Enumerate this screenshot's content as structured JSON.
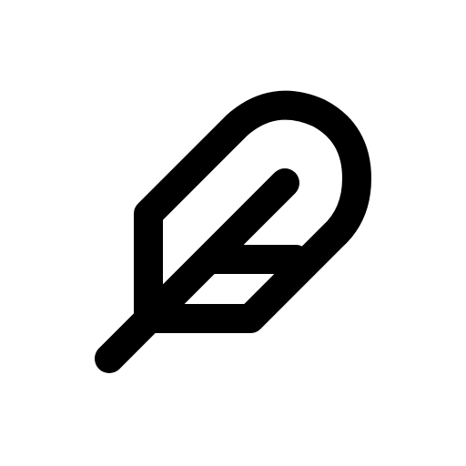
{
  "icon": {
    "name": "feather-icon",
    "stroke_color": "#000000",
    "background_color": "#ffffff"
  }
}
